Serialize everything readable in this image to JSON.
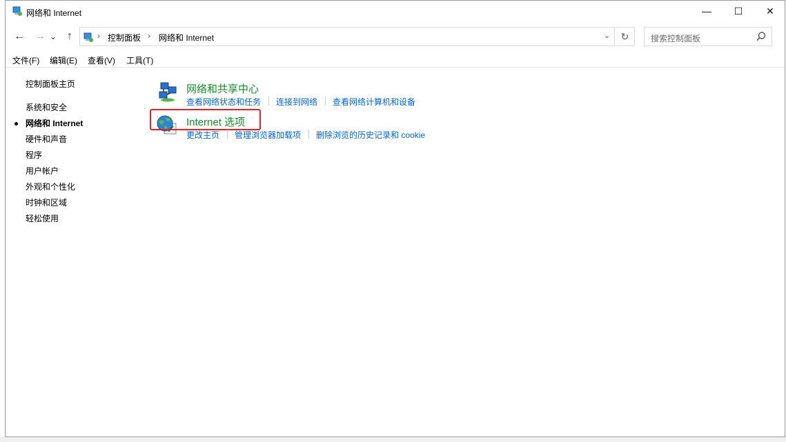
{
  "window": {
    "title": "网络和 Internet",
    "controls": {
      "minimize": "—",
      "maximize": "☐",
      "close": "✕"
    }
  },
  "nav": {
    "back": "←",
    "forward": "→",
    "recent": "⌄",
    "up": "↑"
  },
  "address": {
    "crumbs": [
      "控制面板",
      "网络和 Internet"
    ],
    "separator": "›",
    "dropdown": "⌄",
    "refresh": "↻"
  },
  "search": {
    "placeholder": "搜索控制面板"
  },
  "menu": [
    "文件(F)",
    "编辑(E)",
    "查看(V)",
    "工具(T)"
  ],
  "sidebar": {
    "home": "控制面板主页",
    "items": [
      "系统和安全",
      "网络和 Internet",
      "硬件和声音",
      "程序",
      "用户帐户",
      "外观和个性化",
      "时钟和区域",
      "轻松使用"
    ],
    "current_index": 1
  },
  "categories": [
    {
      "title": "网络和共享中心",
      "icon": "network-sharing-icon",
      "tasks": [
        "查看网络状态和任务",
        "连接到网络",
        "查看网络计算机和设备"
      ]
    },
    {
      "title": "Internet 选项",
      "icon": "internet-options-globe-icon",
      "tasks": [
        "更改主页",
        "管理浏览器加载项",
        "删除浏览的历史记录和 cookie"
      ],
      "highlighted": true
    }
  ],
  "colors": {
    "category_title": "#1a8a2e",
    "link": "#0066cc",
    "highlight_box": "#e02020"
  }
}
